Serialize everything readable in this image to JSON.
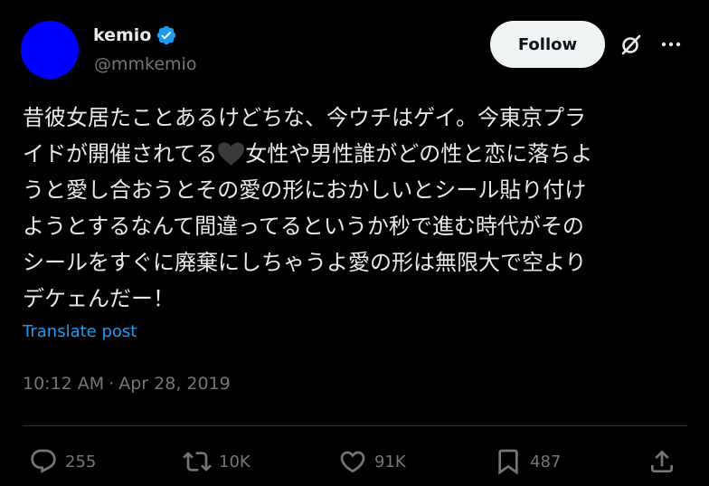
{
  "author": {
    "display_name": "kemio",
    "handle": "@mmkemio",
    "avatar_color": "#0000ff",
    "verified": true,
    "verified_color": "#1d9bf0"
  },
  "header": {
    "follow_label": "Follow",
    "grok_icon": "grok-icon",
    "more_icon": "more-icon"
  },
  "tweet": {
    "lines": [
      "昔彼女居たことあるけどちな、今ウチはゲイ。今東京プラ",
      "イドが開催されてる",
      "女性や男性誰がどの性と恋に落ちよ",
      "うと愛し合おうとその愛の形におかしいとシール貼り付け",
      "ようとするなんて間違ってるというか秒で進む時代がその",
      "シールをすぐに廃棄にしちゃうよ愛の形は無限大で空より",
      "デケェんだー！"
    ],
    "emoji_icon": "black-heart-icon",
    "translate_label": "Translate post",
    "time": "10:12 AM",
    "separator": "·",
    "date": "Apr 28, 2019"
  },
  "actions": {
    "reply_count": "255",
    "repost_count": "10K",
    "like_count": "91K",
    "bookmark_count": "487"
  },
  "colors": {
    "background": "#000000",
    "text": "#e7e9ea",
    "secondary_text": "#71767b",
    "link": "#1d9bf0",
    "divider": "#2f3336",
    "follow_bg": "#eff3f4"
  }
}
